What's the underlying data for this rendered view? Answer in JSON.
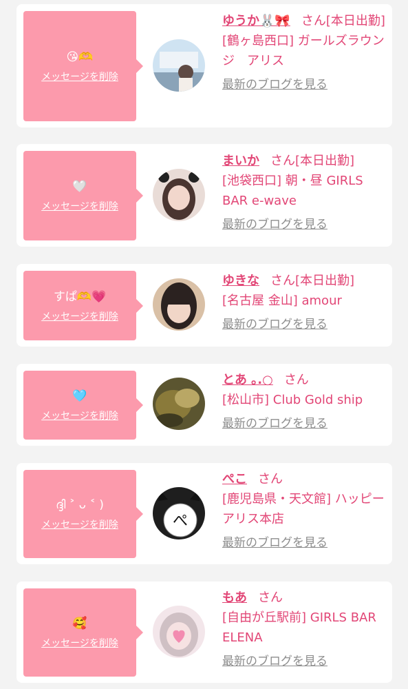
{
  "delete_label": "メッセージを削除",
  "honorific": "さん",
  "blog_label": "最新のブログを見る",
  "colors": {
    "bubble": "#fc9aac",
    "accent": "#e24676",
    "link_gray": "#8d8d8d",
    "background": "#f3f3f3"
  },
  "cards": [
    {
      "message": "😘🫶",
      "name": "ゆうか🐰🎀",
      "status": "[本日出勤]",
      "location": "[鶴ヶ島西口] ガールズラウンジ　アリス"
    },
    {
      "message": "🤍",
      "name": "まいか",
      "status": "[本日出勤]",
      "location": "[池袋西口] 朝・昼 GIRLS BAR e-wave"
    },
    {
      "message": "すぱ🫶💗",
      "name": "ゆきな",
      "status": "[本日出勤]",
      "location": "[名古屋 金山] amour"
    },
    {
      "message": "🩵",
      "name": "とあ ｡.○",
      "status": "",
      "location": "[松山市] Club Gold ship"
    },
    {
      "message": "ദ്ദി ˃ ᴗ ˂ )",
      "name": "ぺこ",
      "status": "",
      "location": "[鹿児島県・天文館] ハッピーアリス本店"
    },
    {
      "message": "🥰",
      "name": "もあ",
      "status": "",
      "location": "[自由が丘駅前] GIRLS BAR ELENA"
    }
  ]
}
